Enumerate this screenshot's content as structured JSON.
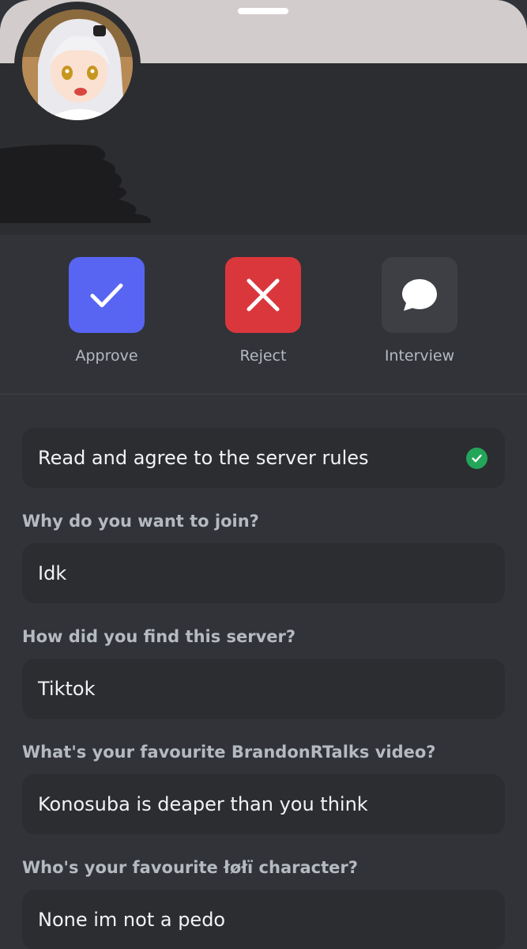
{
  "actions": {
    "approve_label": "Approve",
    "reject_label": "Reject",
    "interview_label": "Interview"
  },
  "rules": {
    "text": "Read and agree to the server rules",
    "status_icon": "check-circle-icon"
  },
  "questions": [
    {
      "question": "Why do you want to join?",
      "answer": "Idk"
    },
    {
      "question": "How did you find this server?",
      "answer": "Tiktok"
    },
    {
      "question": "What's your favourite BrandonRTalks video?",
      "answer": "Konosuba is deaper than you think"
    },
    {
      "question": "Who's your favourite łøłï character?",
      "answer": "None im not a pedo"
    }
  ],
  "colors": {
    "approve": "#5865f2",
    "reject": "#da373c",
    "interview": "#3d3f45",
    "success": "#23a55a",
    "background": "#313338",
    "card": "#2b2d31",
    "banner": "#d2cdcc"
  }
}
